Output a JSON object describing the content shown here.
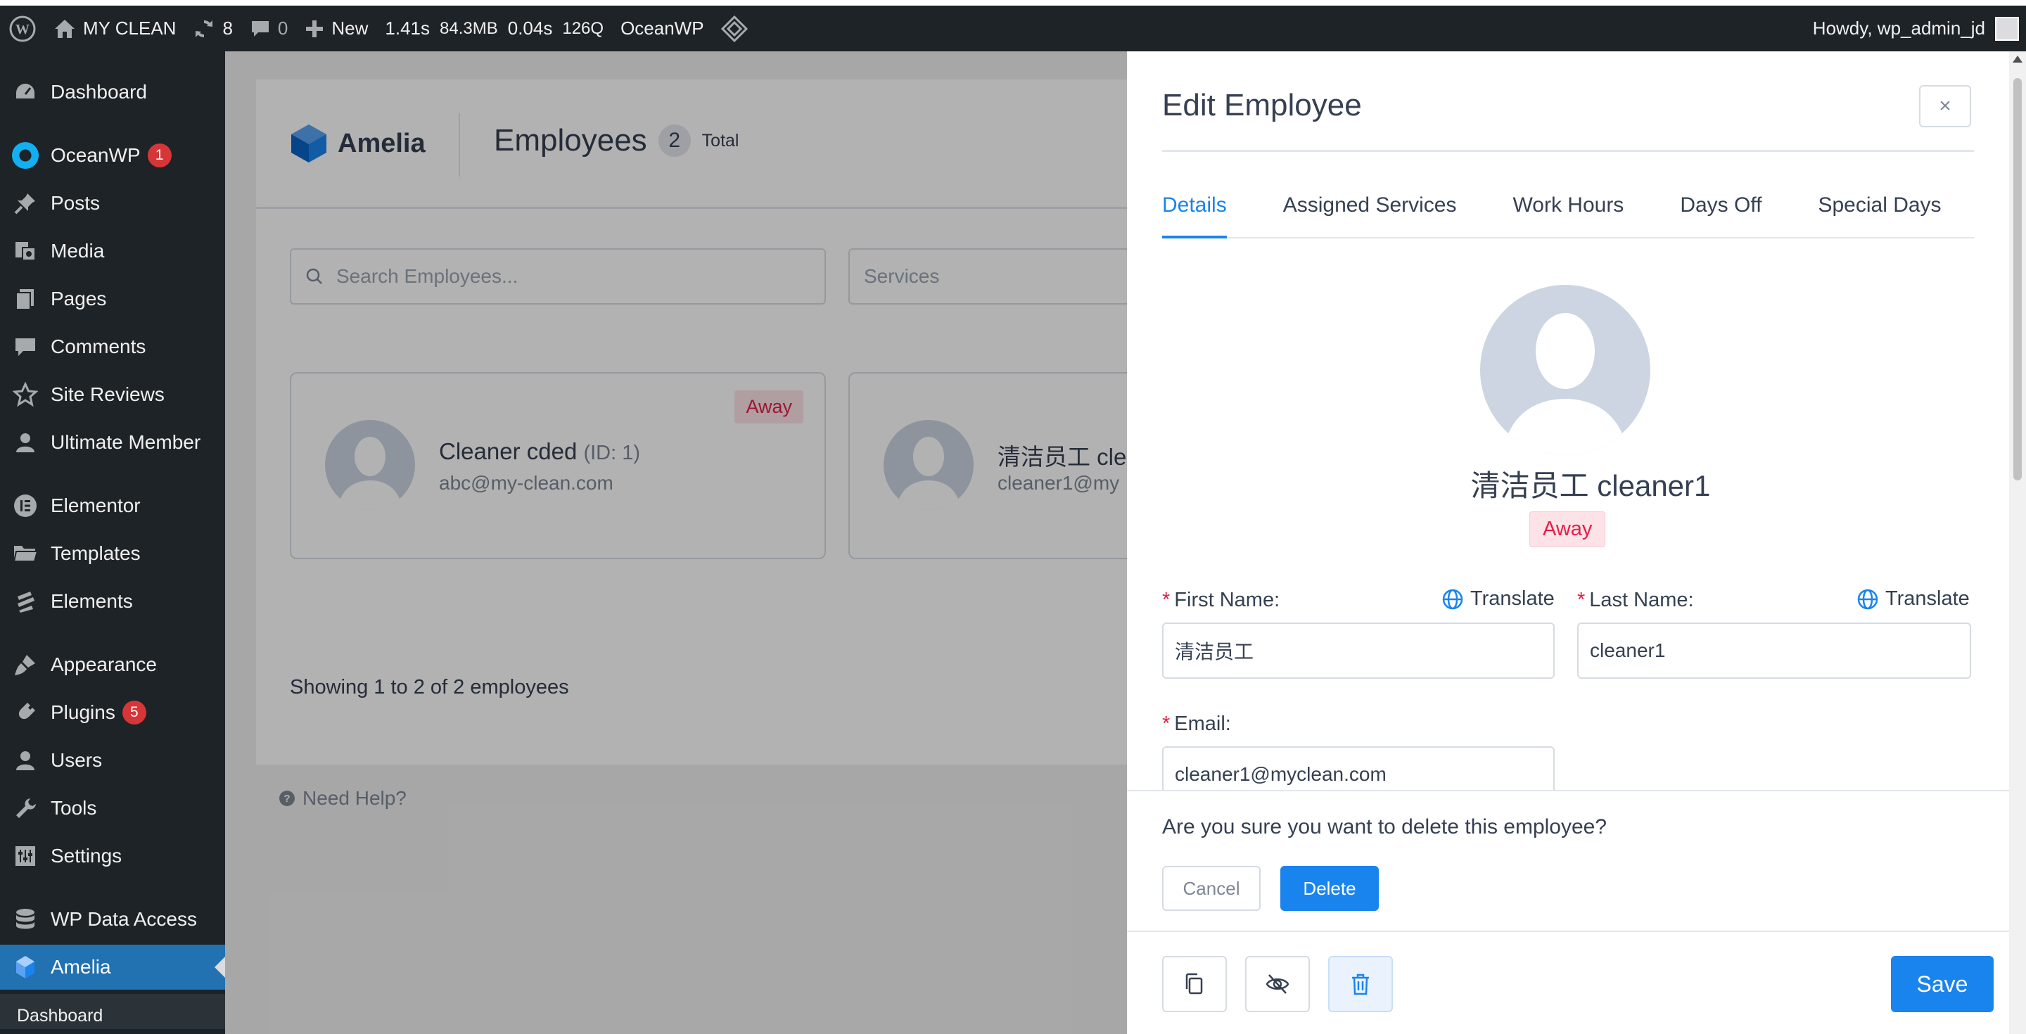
{
  "admin_bar": {
    "site_name": "MY CLEAN",
    "updates_count": "8",
    "comments_count": "0",
    "new_label": "New",
    "qm_time": "1.41s",
    "qm_memory": "84.3MB",
    "qm_db_time": "0.04s",
    "qm_queries": "126Q",
    "theme_label": "OceanWP",
    "greeting": "Howdy, wp_admin_jd"
  },
  "sidebar": {
    "items": [
      {
        "label": "Dashboard",
        "icon": "dashboard-icon"
      },
      {
        "label": "OceanWP",
        "icon": "oceanwp-icon",
        "badge": "1"
      },
      {
        "label": "Posts",
        "icon": "pin-icon"
      },
      {
        "label": "Media",
        "icon": "media-icon"
      },
      {
        "label": "Pages",
        "icon": "pages-icon"
      },
      {
        "label": "Comments",
        "icon": "comment-icon"
      },
      {
        "label": "Site Reviews",
        "icon": "star-icon"
      },
      {
        "label": "Ultimate Member",
        "icon": "user-icon"
      },
      {
        "label": "Elementor",
        "icon": "elementor-icon"
      },
      {
        "label": "Templates",
        "icon": "folder-icon"
      },
      {
        "label": "Elements",
        "icon": "elements-icon"
      },
      {
        "label": "Appearance",
        "icon": "brush-icon"
      },
      {
        "label": "Plugins",
        "icon": "plug-icon",
        "badge": "5"
      },
      {
        "label": "Users",
        "icon": "user-icon"
      },
      {
        "label": "Tools",
        "icon": "wrench-icon"
      },
      {
        "label": "Settings",
        "icon": "settings-icon"
      },
      {
        "label": "WP Data Access",
        "icon": "database-icon"
      },
      {
        "label": "Amelia",
        "icon": "amelia-icon"
      }
    ],
    "sub_item": "Dashboard"
  },
  "page": {
    "logo_text": "Amelia",
    "title": "Employees",
    "count": "2",
    "count_label": "Total",
    "search_placeholder": "Search Employees...",
    "services_placeholder": "Services",
    "showing": "Showing 1 to 2 of 2 employees",
    "need_help": "Need Help?"
  },
  "employees": [
    {
      "name": "Cleaner cded",
      "id": "(ID: 1)",
      "email": "abc@my-clean.com",
      "status": "Away"
    },
    {
      "name": "清洁员工 clea",
      "email": "cleaner1@my"
    }
  ],
  "drawer": {
    "title": "Edit Employee",
    "close": "×",
    "tabs": [
      "Details",
      "Assigned Services",
      "Work Hours",
      "Days Off",
      "Special Days"
    ],
    "employee_name": "清洁员工 cleaner1",
    "status": "Away",
    "first_name_label": "First Name:",
    "last_name_label": "Last Name:",
    "email_label": "Email:",
    "translate_label": "Translate",
    "first_name_value": "清洁员工",
    "last_name_value": "cleaner1",
    "email_value": "cleaner1@myclean.com",
    "required_mark": "*",
    "confirm_text": "Are you sure you want to delete this employee?",
    "cancel_label": "Cancel",
    "delete_label": "Delete",
    "save_label": "Save"
  },
  "colors": {
    "wp_dark": "#1d2327",
    "wp_active": "#2271b1",
    "accent_blue": "#1a84ee",
    "away_red": "#e21f48",
    "badge_red": "#d63638"
  }
}
